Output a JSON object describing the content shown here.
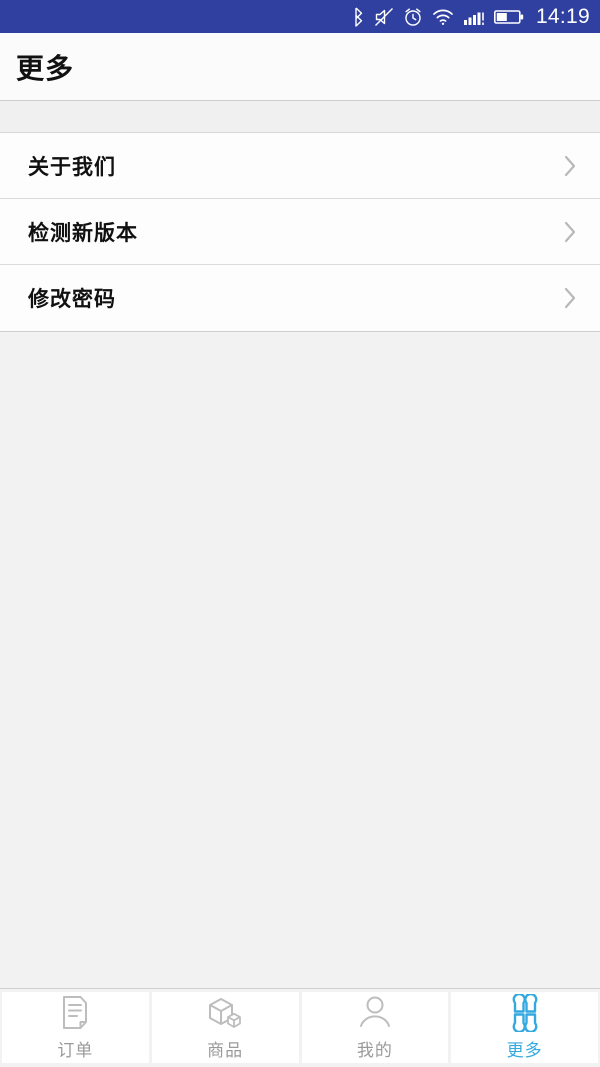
{
  "status_bar": {
    "background": "#3040a0",
    "time": "14:19",
    "icons": [
      {
        "name": "bluetooth-icon"
      },
      {
        "name": "volume-off-icon"
      },
      {
        "name": "alarm-clock-icon"
      },
      {
        "name": "wifi-icon"
      },
      {
        "name": "cellular-signal-icon"
      },
      {
        "name": "battery-icon"
      }
    ]
  },
  "header": {
    "title": "更多"
  },
  "settings_list": {
    "items": [
      {
        "label": "关于我们",
        "chevron": "chevron-right-icon"
      },
      {
        "label": "检测新版本",
        "chevron": "chevron-right-icon"
      },
      {
        "label": "修改密码",
        "chevron": "chevron-right-icon"
      }
    ]
  },
  "tab_bar": {
    "active_color": "#33a9e0",
    "inactive_color": "#9a9a9a",
    "tabs": [
      {
        "label": "订单",
        "icon": "document-icon",
        "active": false
      },
      {
        "label": "商品",
        "icon": "box-icon",
        "active": false
      },
      {
        "label": "我的",
        "icon": "person-icon",
        "active": false
      },
      {
        "label": "更多",
        "icon": "clover-grid-icon",
        "active": true
      }
    ]
  }
}
